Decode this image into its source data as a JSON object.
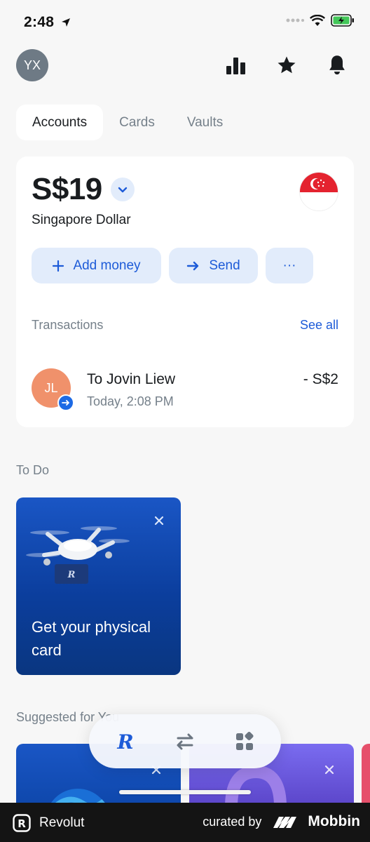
{
  "status_bar": {
    "time": "2:48"
  },
  "header": {
    "avatar_initials": "YX"
  },
  "tabs": [
    {
      "label": "Accounts",
      "active": true
    },
    {
      "label": "Cards",
      "active": false
    },
    {
      "label": "Vaults",
      "active": false
    }
  ],
  "account": {
    "balance": "S$19",
    "currency_name": "Singapore Dollar",
    "actions": {
      "add_money": "Add money",
      "send": "Send",
      "more": "···"
    },
    "transactions": {
      "title": "Transactions",
      "see_all": "See all",
      "items": [
        {
          "initials": "JL",
          "name": "To Jovin Liew",
          "date": "Today, 2:08 PM",
          "amount": "- S$2"
        }
      ]
    }
  },
  "todo": {
    "title": "To Do",
    "card_text": "Get your physical card"
  },
  "suggested": {
    "title": "Suggested for You"
  },
  "footer": {
    "brand": "Revolut",
    "curated_by": "curated by",
    "mobbin": "Mobbin"
  },
  "colors": {
    "accent": "#1d5bd8",
    "promo_blue": "#1a56c5",
    "tx_avatar": "#f0916b",
    "footer_bg": "#141414"
  }
}
